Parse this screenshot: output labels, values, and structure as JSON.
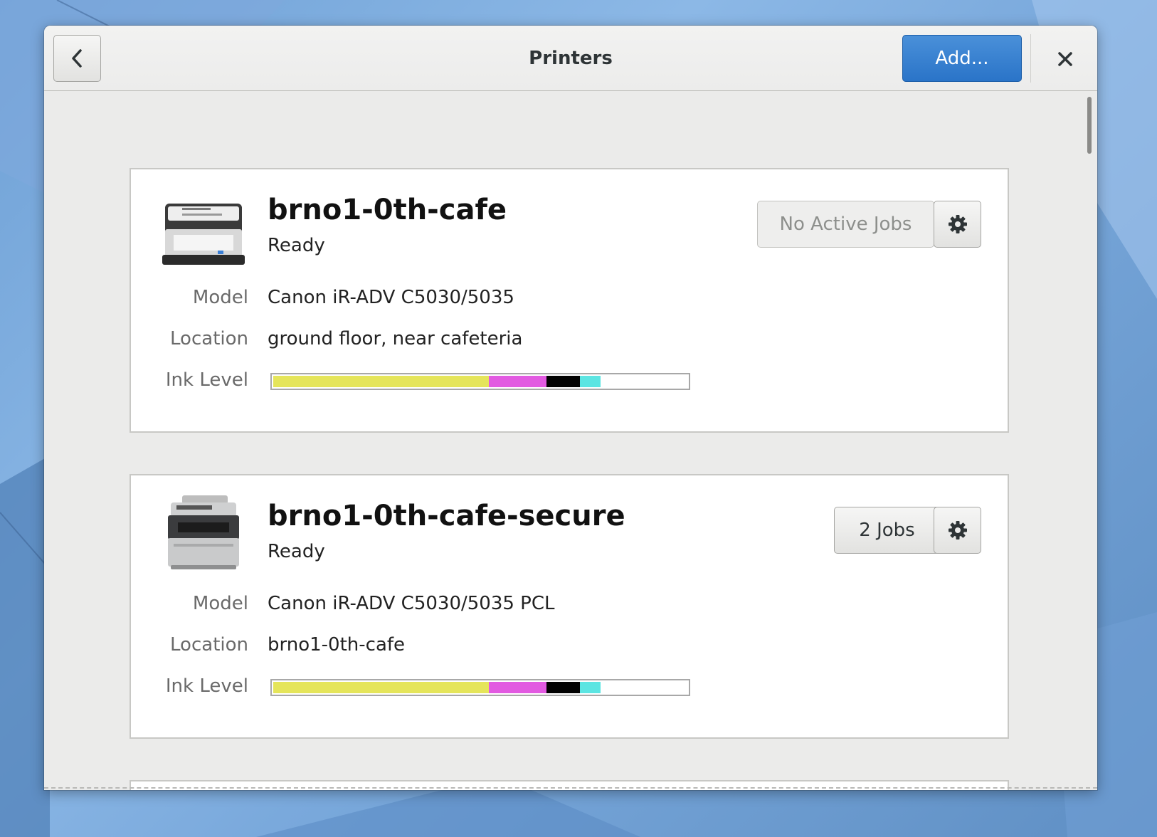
{
  "window": {
    "title": "Printers",
    "add_label": "Add...",
    "accent_color": "#2a74c8"
  },
  "icons": {
    "back": "chevron-left-icon",
    "close": "close-icon",
    "settings": "gear-icon",
    "printer": "printer-icon"
  },
  "printers": [
    {
      "name": "brno1-0th-cafe",
      "status": "Ready",
      "jobs_label": "No Active Jobs",
      "jobs_active": false,
      "model_label": "Model",
      "model": "Canon iR-ADV C5030/5035",
      "location_label": "Location",
      "location": "ground floor, near cafeteria",
      "ink_label": "Ink Level",
      "ink_levels": [
        {
          "color": "#e5e55a",
          "fraction": 0.52
        },
        {
          "color": "#e25ae1",
          "fraction": 0.14
        },
        {
          "color": "#000000",
          "fraction": 0.08
        },
        {
          "color": "#5ce5e2",
          "fraction": 0.05
        }
      ]
    },
    {
      "name": "brno1-0th-cafe-secure",
      "status": "Ready",
      "jobs_label": "2 Jobs",
      "jobs_active": true,
      "model_label": "Model",
      "model": "Canon iR-ADV C5030/5035 PCL",
      "location_label": "Location",
      "location": "brno1-0th-cafe",
      "ink_label": "Ink Level",
      "ink_levels": [
        {
          "color": "#e5e55a",
          "fraction": 0.52
        },
        {
          "color": "#e25ae1",
          "fraction": 0.14
        },
        {
          "color": "#000000",
          "fraction": 0.08
        },
        {
          "color": "#5ce5e2",
          "fraction": 0.05
        }
      ]
    }
  ]
}
